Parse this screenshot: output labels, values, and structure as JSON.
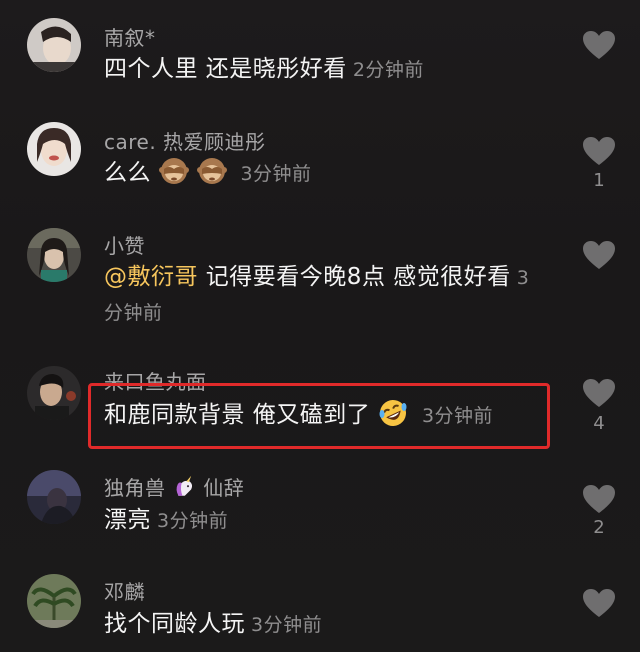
{
  "comments": [
    {
      "username": "南叙*",
      "mention": "",
      "text": "四个人里 还是晓彤好看",
      "time": "2分钟前",
      "likes": ""
    },
    {
      "username": "care. 热爱顾迪彤",
      "mention": "",
      "text": "么么",
      "time": "3分钟前",
      "likes": "1",
      "emojis": [
        "see-no-evil-monkey",
        "see-no-evil-monkey"
      ]
    },
    {
      "username": "小赞",
      "mention": "@敷衍哥",
      "text": " 记得要看今晚8点 感觉很好看",
      "time": "3分钟前",
      "likes": ""
    },
    {
      "username": "来口鱼丸面",
      "mention": "",
      "text": "和鹿同款背景 俺又磕到了",
      "time": "3分钟前",
      "likes": "4",
      "emojis": [
        "rofl-face"
      ]
    },
    {
      "username_prefix": "独角兽",
      "username_suffix": "仙辞",
      "username_emoji": "unicorn",
      "mention": "",
      "text": "漂亮",
      "time": "3分钟前",
      "likes": "2"
    },
    {
      "username": "邓麟",
      "mention": "",
      "text": "找个同龄人玩",
      "time": "3分钟前",
      "likes": ""
    }
  ],
  "colors": {
    "background": "#1c1a1b",
    "username": "#a7a6a7",
    "text": "#f4f4f4",
    "mention": "#f7c65d",
    "time": "#8f8e8f",
    "heart": "#6f6e6f",
    "highlight": "#e02a2a"
  },
  "icons": {
    "like": "heart-icon"
  }
}
